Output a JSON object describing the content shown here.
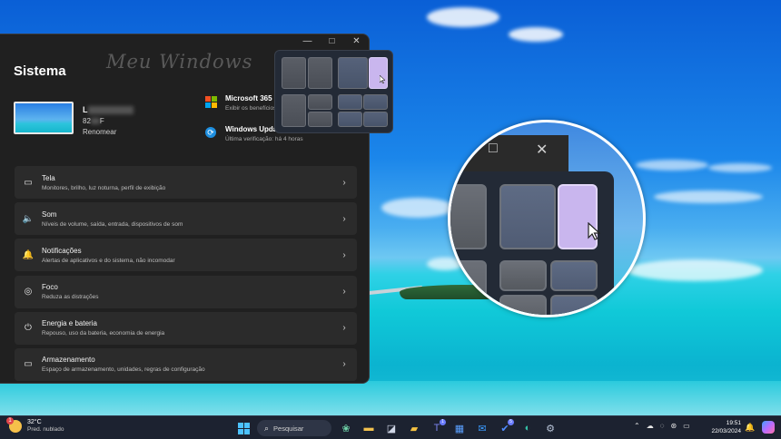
{
  "window": {
    "title": "Sistema",
    "watermark": "Meu Windows",
    "controls": {
      "minimize": "—",
      "maximize": "□",
      "close": "✕"
    },
    "device": {
      "name_visible": "L",
      "model_visible": "82",
      "model_suffix": "F",
      "rename": "Renomear"
    },
    "promos": [
      {
        "icon": "microsoft-365-icon",
        "title": "Microsoft 365",
        "subtitle": "Exibir os benefícios"
      },
      {
        "icon": "windows-update-icon",
        "title": "Windows Update",
        "subtitle": "Última verificação: há 4 horas"
      }
    ],
    "items": [
      {
        "icon": "monitor-icon",
        "glyph": "▭",
        "title": "Tela",
        "subtitle": "Monitores, brilho, luz noturna, perfil de exibição"
      },
      {
        "icon": "speaker-icon",
        "glyph": "🔈",
        "title": "Som",
        "subtitle": "Níveis de volume, saída, entrada, dispositivos de som"
      },
      {
        "icon": "bell-icon",
        "glyph": "🔔",
        "title": "Notificações",
        "subtitle": "Alertas de aplicativos e do sistema, não incomodar"
      },
      {
        "icon": "focus-icon",
        "glyph": "◎",
        "title": "Foco",
        "subtitle": "Reduza as distrações"
      },
      {
        "icon": "power-icon",
        "glyph": "⏻",
        "title": "Energia e bateria",
        "subtitle": "Repouso, uso da bateria, economia de energia"
      },
      {
        "icon": "storage-icon",
        "glyph": "▭",
        "title": "Armazenamento",
        "subtitle": "Espaço de armazenamento, unidades, regras de configuração"
      }
    ],
    "chevron": "›"
  },
  "magnifier": {
    "controls": {
      "maximize": "□",
      "close": "✕"
    }
  },
  "taskbar": {
    "weather": {
      "badge": "1",
      "temp": "32°C",
      "desc": "Pred. nublado"
    },
    "search_label": "Pesquisar",
    "search_icon": "⌕",
    "apps": [
      {
        "name": "widgets-icon",
        "glyph": "❀",
        "color": "#6fd3a8"
      },
      {
        "name": "file-explorer-icon",
        "glyph": "▬",
        "color": "#f2c14e"
      },
      {
        "name": "task-view-icon",
        "glyph": "◪",
        "color": "#cfd6e6"
      },
      {
        "name": "folder-icon",
        "glyph": "▰",
        "color": "#f5c242"
      },
      {
        "name": "teams-icon",
        "glyph": "T",
        "color": "#7b83eb",
        "badge": "1"
      },
      {
        "name": "store-icon",
        "glyph": "▦",
        "color": "#5aa0ff"
      },
      {
        "name": "mail-icon",
        "glyph": "✉",
        "color": "#3b9cff"
      },
      {
        "name": "todo-icon",
        "glyph": "✔",
        "color": "#4f8cff",
        "badge": "5"
      },
      {
        "name": "edge-icon",
        "glyph": "◐",
        "color": "#35c2a8"
      },
      {
        "name": "settings-icon",
        "glyph": "⚙",
        "color": "#b8c4d8"
      }
    ],
    "tray": [
      "⌃",
      "☁",
      "◌",
      "⊛",
      "▭"
    ],
    "clock": {
      "time": "19:51",
      "date": "22/03/2024"
    },
    "tray_end": [
      "🔔"
    ]
  }
}
